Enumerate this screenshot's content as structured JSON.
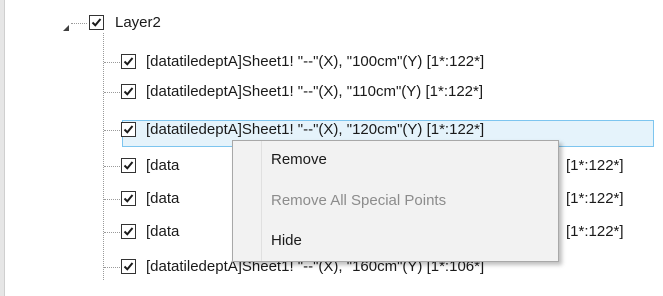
{
  "tree": {
    "layer": {
      "label": "Layer2",
      "checked": true,
      "expanded": true
    },
    "rows": [
      {
        "label": "[datatiledeptA]Sheet1! \"--\"(X), \"100cm\"(Y) [1*:122*]",
        "checked": true
      },
      {
        "label": "[datatiledeptA]Sheet1! \"--\"(X), \"110cm\"(Y) [1*:122*]",
        "checked": true
      },
      {
        "label": "[datatiledeptA]Sheet1! \"--\"(X), \"120cm\"(Y) [1*:122*]",
        "checked": true,
        "selected": true
      },
      {
        "label": "[data",
        "tail": "[1*:122*]",
        "checked": true
      },
      {
        "label": "[data",
        "tail": "[1*:122*]",
        "checked": true
      },
      {
        "label": "[data",
        "tail": "[1*:122*]",
        "checked": true
      },
      {
        "label": "[datatiledeptA]Sheet1! \"--\"(X), \"160cm\"(Y) [1*:106*]",
        "checked": true
      }
    ]
  },
  "context_menu": {
    "items": [
      {
        "label": "Remove",
        "enabled": true
      },
      {
        "label": "Remove All Special Points",
        "enabled": false
      },
      {
        "label": "Hide",
        "enabled": true
      }
    ]
  },
  "colors": {
    "selection_bg": "#e5f3fb",
    "selection_border": "#7dc5ef",
    "menu_bg": "#f2f2f2",
    "disabled_text": "#8c8c8c"
  }
}
